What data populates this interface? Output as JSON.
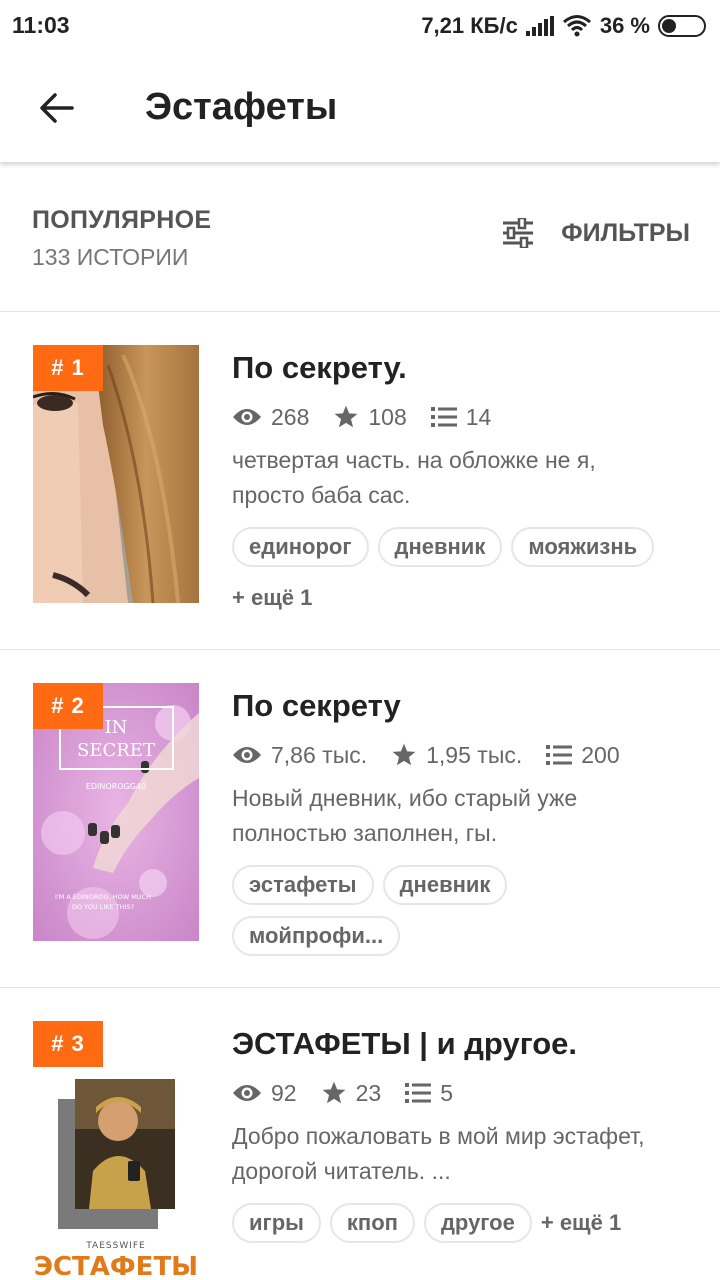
{
  "status_bar": {
    "time": "11:03",
    "speed": "7,21 КБ/с",
    "battery": "36 %",
    "battery_level": 0.36
  },
  "app_bar": {
    "title": "Эстафеты",
    "back_icon": "arrow-back-icon"
  },
  "section": {
    "title": "ПОПУЛЯРНОЕ",
    "count": "133 ИСТОРИИ",
    "filter_label": "ФИЛЬТРЫ",
    "filter_icon": "sliders-icon"
  },
  "stories": [
    {
      "rank": "# 1",
      "title": "По секрету.",
      "views": "268",
      "votes": "108",
      "parts": "14",
      "description_line1": "четвертая часть. на обложке не я,",
      "description_line2": "просто баба сас.",
      "tags": [
        "единорог",
        "дневник",
        "мояжизнь"
      ],
      "more": "+ ещё 1"
    },
    {
      "rank": "# 2",
      "title": "По секрету",
      "views": "7,86 тыс.",
      "votes": "1,95 тыс.",
      "parts": "200",
      "description_line1": "Новый дневник, ибо старый уже",
      "description_line2": "полностью заполнен, гы.",
      "tags": [
        "эстафеты",
        "дневник",
        "мойпрофи..."
      ],
      "cover_text": {
        "line1": "IN",
        "line2": "SECRET",
        "author": "EDINOROGG40",
        "bottom1": "I'M A EDINOROG, HOW MUCH",
        "bottom2": "DO YOU LIKE THIS?"
      }
    },
    {
      "rank": "# 3",
      "title": "ЭСТАФЕТЫ | и другое.",
      "views": "92",
      "votes": "23",
      "parts": "5",
      "description_line1": "Добро пожаловать в мой мир эстафет,",
      "description_line2": "дорогой читатель. ...",
      "tags": [
        "игры",
        "кпоп",
        "другое"
      ],
      "more": "+ ещё 1",
      "cover_text": {
        "author": "TAESSWIFE",
        "title": "ЭСТАФЕТЫ"
      }
    }
  ],
  "colors": {
    "accent": "#ff6a13",
    "text_primary": "#222222",
    "text_secondary": "#666666"
  }
}
